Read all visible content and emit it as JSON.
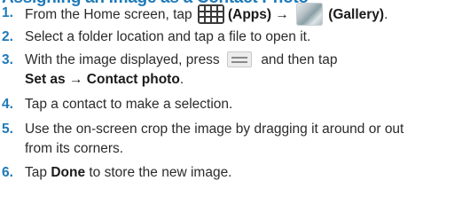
{
  "heading": "Assigning an Image as a Contact Photo",
  "steps": [
    {
      "num": "1.",
      "prefix": "From the Home screen, tap",
      "apps_label": "(Apps)",
      "arrow": "→",
      "gallery_label": "(Gallery)",
      "suffix": ".",
      "apps_icon": "apps-grid-icon",
      "gallery_icon": "gallery-icon"
    },
    {
      "num": "2.",
      "text": "Select a folder location and tap a file to open it."
    },
    {
      "num": "3.",
      "prefix": "With the image displayed, press",
      "suffix": "and then tap",
      "menu_icon": "menu-icon",
      "line2_bold": "Set as → Contact photo",
      "line2_end": "."
    },
    {
      "num": "4.",
      "text": "Tap a contact to make a selection."
    },
    {
      "num": "5.",
      "line1": "Use the on-screen crop the image by dragging it around or out",
      "line2": "from its corners."
    },
    {
      "num": "6.",
      "prefix": "Tap",
      "bold": "Done",
      "suffix": "to store the new image."
    }
  ]
}
